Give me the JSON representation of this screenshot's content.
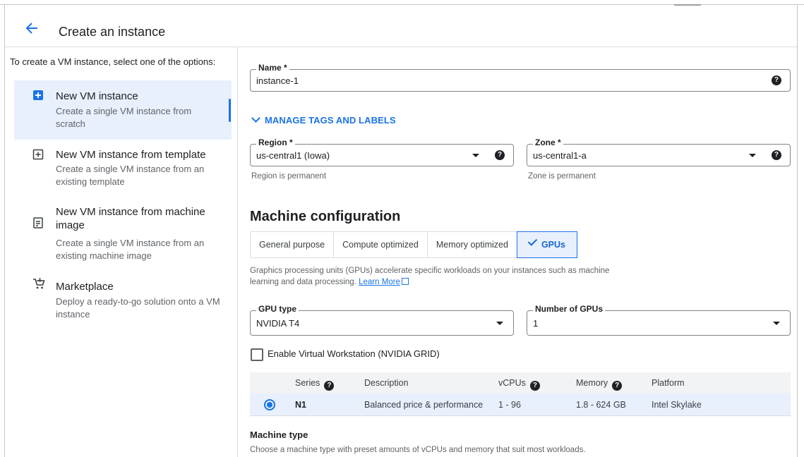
{
  "header": {
    "title": "Create an instance"
  },
  "left": {
    "intro": "To create a VM instance, select one of the options:",
    "options": [
      {
        "title": "New VM instance",
        "description": "Create a single VM instance from scratch",
        "icon": "add-box-icon",
        "selected": true
      },
      {
        "title": "New VM instance from template",
        "description": "Create a single VM instance from an existing template",
        "icon": "template-icon",
        "selected": false
      },
      {
        "title": "New VM instance from machine image",
        "description": "Create a single VM instance from an existing machine image",
        "icon": "machine-image-icon",
        "selected": false
      },
      {
        "title": "Marketplace",
        "description": "Deploy a ready-to-go solution onto a VM instance",
        "icon": "cart-icon",
        "selected": false
      }
    ]
  },
  "form": {
    "name": {
      "label": "Name *",
      "value": "instance-1"
    },
    "manage_tags": "MANAGE TAGS AND LABELS",
    "region": {
      "label": "Region *",
      "value": "us-central1 (Iowa)",
      "hint": "Region is permanent"
    },
    "zone": {
      "label": "Zone *",
      "value": "us-central1-a",
      "hint": "Zone is permanent"
    }
  },
  "machine": {
    "title": "Machine configuration",
    "tabs": [
      "General purpose",
      "Compute optimized",
      "Memory optimized",
      "GPUs"
    ],
    "active_tab": "GPUs",
    "gpu_description": "Graphics processing units (GPUs) accelerate specific workloads on your instances such as machine learning and data processing.",
    "learn_more": "Learn More",
    "gpu_type": {
      "label": "GPU type",
      "value": "NVIDIA T4"
    },
    "gpu_count": {
      "label": "Number of GPUs",
      "value": "1"
    },
    "virtual_workstation": {
      "label": "Enable Virtual Workstation (NVIDIA GRID)",
      "checked": false
    },
    "series_table": {
      "headers": [
        "Series",
        "Description",
        "vCPUs",
        "Memory",
        "Platform"
      ],
      "rows": [
        {
          "series": "N1",
          "description": "Balanced price & performance",
          "vcpus": "1 - 96",
          "memory": "1.8 - 624 GB",
          "platform": "Intel Skylake",
          "selected": true
        }
      ]
    },
    "machine_type": {
      "title": "Machine type",
      "description": "Choose a machine type with preset amounts of vCPUs and memory that suit most workloads."
    }
  },
  "colors": {
    "accent": "#1a73e8",
    "selected_bg": "#e8f0fe",
    "text": "#202124",
    "muted": "#5f6368"
  }
}
